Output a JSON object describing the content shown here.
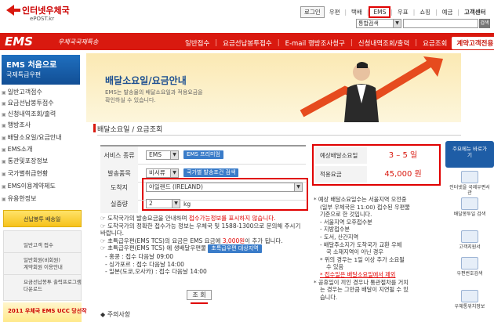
{
  "header": {
    "logo_title": "인터넷우체국",
    "logo_sub": "ePOST.kr",
    "links": [
      "로그인",
      "우편",
      "택배",
      "EMS",
      "우표",
      "쇼핑",
      "예금",
      "고객센터"
    ],
    "search_select": "통합검색",
    "search_button": "검색"
  },
  "menubar": {
    "logo": "EMS",
    "logo_sub": "우체국국제특송",
    "items": [
      "일반접수",
      "요금선납봉투접수",
      "E-mail 행방조사청구",
      "신청내역조회/출력",
      "요금조회"
    ],
    "biz_button": "계약고객전용 시스템"
  },
  "sidebar": {
    "head_title": "EMS 처음으로",
    "head_sub": "국제특급우편",
    "items": [
      "일반고객접수",
      "요금선납봉투접수",
      "신청내역조회/출력",
      "행방조사",
      "배달소요일/요금안내",
      "EMS소개",
      "통관및포장정보",
      "국가별취급현황",
      "EMS이용계약제도",
      "유용한정보"
    ],
    "yellow_banner": "선납봉투 배송일",
    "banner1": "일반고객 접수",
    "banner2a": "일반회원(비회원)",
    "banner2b": "계약회원 이용안내",
    "banner3a": "요금선납봉투 출력프로그램",
    "banner3b": "다운로드",
    "bottom": "2011 우체국 EMS UCC 당선작"
  },
  "banner": {
    "title": "배달소요일/요금안내",
    "sub1": "EMS는 발송물의 배달소요일과 적용요금을",
    "sub2": "확인하실 수 있습니다."
  },
  "page_title": "배달소요일 / 요금조회",
  "form": {
    "service_label": "서비스 종류",
    "service_value": "EMS",
    "service_btn": "EMS 프리미엄",
    "item_label": "발송품목",
    "item_value": "비서류",
    "item_btn": "국가별 발송조건 검색",
    "dest_label": "도착지",
    "dest_value": "아일랜드 (IRELAND)",
    "weight_label": "실중량",
    "weight_value": "2",
    "weight_unit": "kg"
  },
  "notes": {
    "n1a": "☞ 도착국가의 발송요금을 안내하며 ",
    "n1b": "접수가능정보를 표시하지 않습니다.",
    "n2": "☞ 도착국가의 정확한 접수가능 정보는 우체국 및 1588-1300으로 문의해 주시기 바랍니다.",
    "n3a": "☞ 초특급우편(EMS TCS)의 요금은 EMS 요금에 ",
    "n3b": "3,000원",
    "n3c": "이 추가 됩니다.",
    "n4": "☞ 초특급우편(EMS TCS) 에 생배달우편물",
    "n4_btn": "초특급우편 대상지역",
    "n5": "- 홍콩 : 접수 다음날 09:00",
    "n6": "- 싱가포르 : 접수 다음날 14:00",
    "n7": "- 일본(도쿄,오사카) : 접수 다음날 14:00"
  },
  "search_button": "조 회",
  "caution": "◆ 주의사항",
  "result": {
    "days_label": "예상배달소요일",
    "days_value": "3 – 5 일",
    "fee_label": "적용요금",
    "fee_value": "45,000 원"
  },
  "info": {
    "l1": "* 예상 배달소요일수는 서울지역 오전중",
    "l2": "(일부 우체국은 11:00) 접수된 우편물",
    "l3": "기준으로 한 것입니다.",
    "l4": "- 서울지역 오후접수분",
    "l5": "- 지방접수분",
    "l6": "- 도서, 산간지역",
    "l7": "- 배달주소지가 도착국가 교환 우체",
    "l8": "국 소재지역이 아닌 경우",
    "l9": "* 위의 경우는 1일 이상 추가 소요될",
    "l10": "수 있음",
    "l11": "* 접수일은 배달소요일에서 제외",
    "l12": "* 공휴일이 끼인 경우나 통관절차를 거치",
    "l13": "는 경우는 그만큼 배달이 지연될 수 있",
    "l14": "습니다."
  },
  "quick": {
    "top": "주요메뉴 바로가기",
    "items": [
      "인터넷을 국제우편서관",
      "배달봉투일 검색",
      "고객지원서",
      "우편번호검색",
      "우체통위치정보"
    ]
  },
  "colors": {
    "accent": "#d9190f",
    "blue": "#1d4f91",
    "highlight": "#e00000"
  }
}
